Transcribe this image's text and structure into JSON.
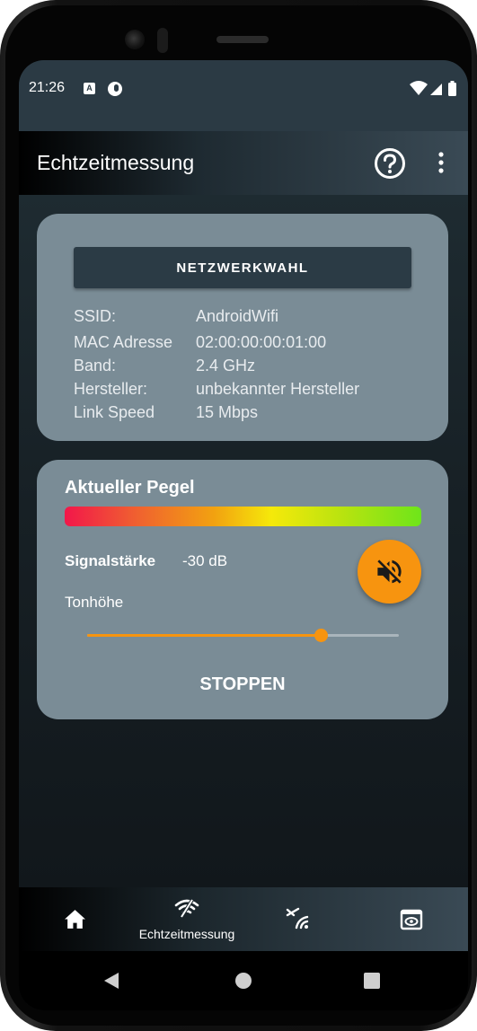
{
  "status_bar": {
    "time": "21:26",
    "icons": [
      "notification-a-icon",
      "notification-circle-icon",
      "wifi-icon",
      "cellular-icon",
      "battery-icon"
    ],
    "badge_letter": "A"
  },
  "app_bar": {
    "title": "Echtzeitmessung",
    "actions": [
      "help-icon",
      "more-vert-icon"
    ]
  },
  "network_card": {
    "select_button": "NETZWERKWAHL",
    "rows": [
      {
        "label": "SSID:",
        "value": "AndroidWifi"
      },
      {
        "label": "MAC Adresse",
        "value": "02:00:00:00:01:00"
      },
      {
        "label": "Band:",
        "value": "2.4 GHz"
      },
      {
        "label": "Hersteller:",
        "value": "unbekannter Hersteller"
      },
      {
        "label": "Link Speed",
        "value": "15 Mbps"
      }
    ]
  },
  "level_card": {
    "title": "Aktueller Pegel",
    "signal_label": "Signalstärke",
    "signal_value": "-30 dB",
    "pitch_label": "Tonhöhe",
    "pitch_fraction": 0.75,
    "mute_icon": "volume-off-icon",
    "stop_button": "STOPPEN"
  },
  "bottom_nav": {
    "items": [
      {
        "icon": "home-icon",
        "label": ""
      },
      {
        "icon": "wifi-measure-icon",
        "label": "Echtzeitmessung",
        "active": true
      },
      {
        "icon": "signal-scan-icon",
        "label": ""
      },
      {
        "icon": "preview-icon",
        "label": ""
      }
    ]
  },
  "system_nav": [
    "back-icon",
    "home-circle-icon",
    "recents-icon"
  ],
  "colors": {
    "accent": "#f7940f",
    "card": "#7a8c96",
    "button_dark": "#2b3b45",
    "status_bar": "#2b3a44"
  }
}
